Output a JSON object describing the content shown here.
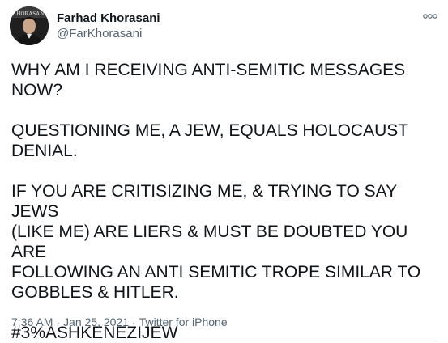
{
  "author": {
    "display_name": "Farhad Khorasani",
    "handle": "@FarKhorasani",
    "avatar_text": "KHORASANI"
  },
  "tweet": {
    "paragraphs": [
      "WHY AM I RECEIVING ANTI-SEMITIC MESSAGES NOW?",
      "QUESTIONING ME, A JEW, EQUALS HOLOCAUST\nDENIAL.",
      "IF YOU ARE CRITISIZING ME, & TRYING TO SAY JEWS\n(LIKE ME) ARE LIERS & MUST BE DOUBTED YOU ARE\nFOLLOWING AN ANTI SEMITIC TROPE SIMILAR TO\nGOBBLES & HITLER.",
      "#3%ASHKENEZIJEW"
    ],
    "time": "7:36 AM",
    "date": "Jan 25, 2021",
    "source": "Twitter for iPhone",
    "separator": "·"
  },
  "icons": {
    "more": "more-horizontal-icon"
  },
  "colors": {
    "text": "#0f1419",
    "secondary": "#536471"
  }
}
